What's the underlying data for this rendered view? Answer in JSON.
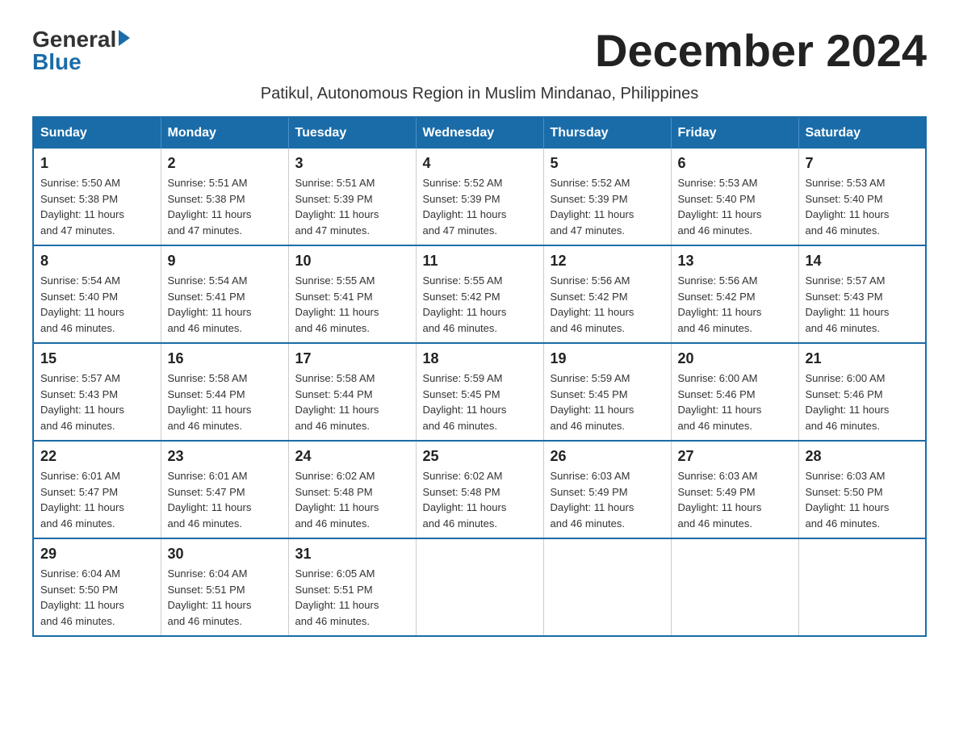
{
  "logo": {
    "general": "General",
    "blue": "Blue"
  },
  "title": "December 2024",
  "subtitle": "Patikul, Autonomous Region in Muslim Mindanao, Philippines",
  "days_of_week": [
    "Sunday",
    "Monday",
    "Tuesday",
    "Wednesday",
    "Thursday",
    "Friday",
    "Saturday"
  ],
  "weeks": [
    [
      {
        "day": "1",
        "sunrise": "5:50 AM",
        "sunset": "5:38 PM",
        "daylight": "11 hours and 47 minutes."
      },
      {
        "day": "2",
        "sunrise": "5:51 AM",
        "sunset": "5:38 PM",
        "daylight": "11 hours and 47 minutes."
      },
      {
        "day": "3",
        "sunrise": "5:51 AM",
        "sunset": "5:39 PM",
        "daylight": "11 hours and 47 minutes."
      },
      {
        "day": "4",
        "sunrise": "5:52 AM",
        "sunset": "5:39 PM",
        "daylight": "11 hours and 47 minutes."
      },
      {
        "day": "5",
        "sunrise": "5:52 AM",
        "sunset": "5:39 PM",
        "daylight": "11 hours and 47 minutes."
      },
      {
        "day": "6",
        "sunrise": "5:53 AM",
        "sunset": "5:40 PM",
        "daylight": "11 hours and 46 minutes."
      },
      {
        "day": "7",
        "sunrise": "5:53 AM",
        "sunset": "5:40 PM",
        "daylight": "11 hours and 46 minutes."
      }
    ],
    [
      {
        "day": "8",
        "sunrise": "5:54 AM",
        "sunset": "5:40 PM",
        "daylight": "11 hours and 46 minutes."
      },
      {
        "day": "9",
        "sunrise": "5:54 AM",
        "sunset": "5:41 PM",
        "daylight": "11 hours and 46 minutes."
      },
      {
        "day": "10",
        "sunrise": "5:55 AM",
        "sunset": "5:41 PM",
        "daylight": "11 hours and 46 minutes."
      },
      {
        "day": "11",
        "sunrise": "5:55 AM",
        "sunset": "5:42 PM",
        "daylight": "11 hours and 46 minutes."
      },
      {
        "day": "12",
        "sunrise": "5:56 AM",
        "sunset": "5:42 PM",
        "daylight": "11 hours and 46 minutes."
      },
      {
        "day": "13",
        "sunrise": "5:56 AM",
        "sunset": "5:42 PM",
        "daylight": "11 hours and 46 minutes."
      },
      {
        "day": "14",
        "sunrise": "5:57 AM",
        "sunset": "5:43 PM",
        "daylight": "11 hours and 46 minutes."
      }
    ],
    [
      {
        "day": "15",
        "sunrise": "5:57 AM",
        "sunset": "5:43 PM",
        "daylight": "11 hours and 46 minutes."
      },
      {
        "day": "16",
        "sunrise": "5:58 AM",
        "sunset": "5:44 PM",
        "daylight": "11 hours and 46 minutes."
      },
      {
        "day": "17",
        "sunrise": "5:58 AM",
        "sunset": "5:44 PM",
        "daylight": "11 hours and 46 minutes."
      },
      {
        "day": "18",
        "sunrise": "5:59 AM",
        "sunset": "5:45 PM",
        "daylight": "11 hours and 46 minutes."
      },
      {
        "day": "19",
        "sunrise": "5:59 AM",
        "sunset": "5:45 PM",
        "daylight": "11 hours and 46 minutes."
      },
      {
        "day": "20",
        "sunrise": "6:00 AM",
        "sunset": "5:46 PM",
        "daylight": "11 hours and 46 minutes."
      },
      {
        "day": "21",
        "sunrise": "6:00 AM",
        "sunset": "5:46 PM",
        "daylight": "11 hours and 46 minutes."
      }
    ],
    [
      {
        "day": "22",
        "sunrise": "6:01 AM",
        "sunset": "5:47 PM",
        "daylight": "11 hours and 46 minutes."
      },
      {
        "day": "23",
        "sunrise": "6:01 AM",
        "sunset": "5:47 PM",
        "daylight": "11 hours and 46 minutes."
      },
      {
        "day": "24",
        "sunrise": "6:02 AM",
        "sunset": "5:48 PM",
        "daylight": "11 hours and 46 minutes."
      },
      {
        "day": "25",
        "sunrise": "6:02 AM",
        "sunset": "5:48 PM",
        "daylight": "11 hours and 46 minutes."
      },
      {
        "day": "26",
        "sunrise": "6:03 AM",
        "sunset": "5:49 PM",
        "daylight": "11 hours and 46 minutes."
      },
      {
        "day": "27",
        "sunrise": "6:03 AM",
        "sunset": "5:49 PM",
        "daylight": "11 hours and 46 minutes."
      },
      {
        "day": "28",
        "sunrise": "6:03 AM",
        "sunset": "5:50 PM",
        "daylight": "11 hours and 46 minutes."
      }
    ],
    [
      {
        "day": "29",
        "sunrise": "6:04 AM",
        "sunset": "5:50 PM",
        "daylight": "11 hours and 46 minutes."
      },
      {
        "day": "30",
        "sunrise": "6:04 AM",
        "sunset": "5:51 PM",
        "daylight": "11 hours and 46 minutes."
      },
      {
        "day": "31",
        "sunrise": "6:05 AM",
        "sunset": "5:51 PM",
        "daylight": "11 hours and 46 minutes."
      },
      null,
      null,
      null,
      null
    ]
  ],
  "labels": {
    "sunrise": "Sunrise:",
    "sunset": "Sunset:",
    "daylight": "Daylight:"
  }
}
